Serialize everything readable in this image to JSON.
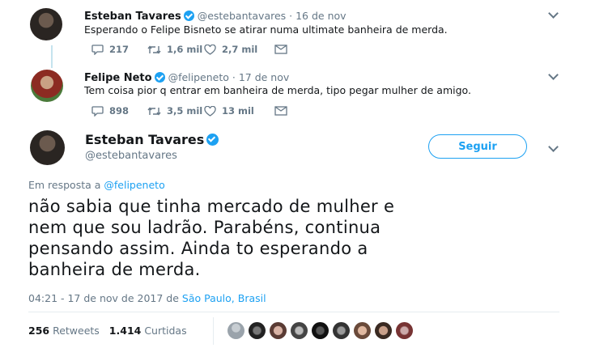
{
  "tweet1": {
    "name": "Esteban Tavares",
    "handle": "@estebantavares",
    "date": "16 de nov",
    "text": "Esperando o Felipe Bisneto se atirar numa ultimate banheira de merda.",
    "replies": "217",
    "retweets": "1,6 mil",
    "likes": "2,7 mil"
  },
  "tweet2": {
    "name": "Felipe Neto",
    "handle": "@felipeneto",
    "date": "17 de nov",
    "text": "Tem coisa pior q entrar em banheira de merda, tipo pegar mulher de amigo.",
    "replies": "898",
    "retweets": "3,5 mil",
    "likes": "13 mil"
  },
  "main": {
    "name": "Esteban Tavares",
    "handle": "@estebantavares",
    "follow_label": "Seguir",
    "reply_prefix": "Em resposta a",
    "reply_to": "@felipeneto",
    "text_lines": [
      "não sabia que tinha mercado de mulher e",
      "nem que sou ladrão. Parabéns, continua",
      "pensando assim. Ainda to esperando a",
      "banheira de merda."
    ],
    "time": "04:21 - 17 de nov de 2017 de",
    "location": "São Paulo, Brasil",
    "retweets_count": "256",
    "retweets_label": "Retweets",
    "likes_count": "1.414",
    "likes_label": "Curtidas"
  },
  "colors": {
    "accent": "#1da1f2",
    "muted": "#657786",
    "thread": "#c5e3ee"
  },
  "icons": {
    "reply": "reply-icon",
    "retweet": "retweet-icon",
    "like": "heart-icon",
    "dm": "envelope-icon",
    "verified": "verified-badge-icon",
    "more": "chevron-down-icon"
  }
}
